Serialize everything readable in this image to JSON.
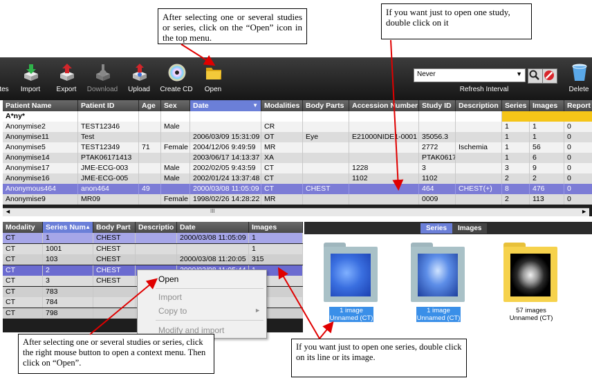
{
  "callouts": {
    "top_left": "After selecting one or several studies or series, click on the “Open” icon in the top menu.",
    "top_right": "If you want just to open one study, double click on it",
    "bottom_left": "After selecting one or several studies or series, click the right mouse button to open a context menu. Then click on “Open”.",
    "bottom_right": "If you want just to open one series, double click on its line or its image."
  },
  "toolbar": {
    "items": [
      {
        "label": "tes",
        "icon": "partial-icon"
      },
      {
        "label": "Import",
        "icon": "import-icon"
      },
      {
        "label": "Export",
        "icon": "export-icon"
      },
      {
        "label": "Download",
        "icon": "download-icon"
      },
      {
        "label": "Upload",
        "icon": "upload-icon"
      },
      {
        "label": "Create CD",
        "icon": "cd-icon"
      },
      {
        "label": "Open",
        "icon": "folder-icon"
      },
      {
        "label": "Delete",
        "icon": "trash-icon"
      }
    ],
    "refresh_value": "Never",
    "refresh_label": "Refresh Interval"
  },
  "studies": {
    "headers": [
      "Patient Name",
      "Patient ID",
      "Age",
      "Sex",
      "Date",
      "Modalities",
      "Body Parts",
      "Accession Number",
      "Study ID",
      "Description",
      "Series",
      "Images",
      "Report"
    ],
    "filter": "A*ny*",
    "rows": [
      [
        "Anonymise2",
        "TEST12346",
        "",
        "Male",
        "",
        "CR",
        "",
        "",
        "",
        "",
        "1",
        "1",
        "0"
      ],
      [
        "Anonymise11",
        "Test",
        "",
        "",
        "2006/03/09 15:31:09",
        "OT",
        "Eye",
        "E21000NIDE1-0001",
        "35056.3",
        "",
        "1",
        "1",
        "0"
      ],
      [
        "Anonymise5",
        "TEST12349",
        "71",
        "Female",
        "2004/12/06 9:49:59",
        "MR",
        "",
        "",
        "2772",
        "Ischemia",
        "1",
        "56",
        "0"
      ],
      [
        "Anonymise14",
        "PTAK06171413",
        "",
        "",
        "2003/06/17 14:13:37",
        "XA",
        "",
        "",
        "PTAK0617",
        "",
        "1",
        "6",
        "0"
      ],
      [
        "Anonymise17",
        "JME-ECG-003",
        "",
        "Male",
        "2002/02/05 9:43:59",
        "CT",
        "",
        "1228",
        "3",
        "",
        "3",
        "9",
        "0"
      ],
      [
        "Anonymise16",
        "JME-ECG-005",
        "",
        "Male",
        "2002/01/24 13:37:48",
        "CT",
        "",
        "1102",
        "1102",
        "",
        "2",
        "2",
        "0"
      ],
      [
        "Anonymous464",
        "anon464",
        "49",
        "",
        "2000/03/08 11:05:09",
        "CT",
        "CHEST",
        "",
        "464",
        "CHEST(+)",
        "8",
        "476",
        "0"
      ],
      [
        "Anonymise9",
        "MR09",
        "",
        "Female",
        "1998/02/26 14:28:22",
        "MR",
        "",
        "",
        "0009",
        "",
        "2",
        "113",
        "0"
      ]
    ],
    "scroll_handle": "III"
  },
  "series": {
    "headers": [
      "Modality",
      "Series Num",
      "Body Part",
      "Descriptio",
      "Date",
      "Images"
    ],
    "rows": [
      [
        "CT",
        "1",
        "CHEST",
        "",
        "2000/03/08 11:05:09",
        "1"
      ],
      [
        "CT",
        "1001",
        "CHEST",
        "",
        "",
        "1"
      ],
      [
        "CT",
        "103",
        "CHEST",
        "",
        "2000/03/08 11:20:05",
        "315"
      ],
      [
        "CT",
        "2",
        "CHEST",
        "",
        "2000/03/08 11:05:44",
        "1"
      ],
      [
        "CT",
        "3",
        "CHEST",
        "",
        "",
        ""
      ],
      [
        "CT",
        "783",
        "",
        "",
        "",
        ""
      ],
      [
        "CT",
        "784",
        "",
        "",
        "",
        ""
      ],
      [
        "CT",
        "798",
        "",
        "",
        "",
        ""
      ]
    ]
  },
  "thumbs": {
    "tabs": [
      "Series",
      "Images"
    ],
    "items": [
      {
        "count": "1 image",
        "name": "Unnamed (CT)"
      },
      {
        "count": "1 image",
        "name": "Unnamed (CT)"
      },
      {
        "count": "57 images",
        "name": "Unnamed (CT)"
      }
    ]
  },
  "context_menu": {
    "items": [
      "Open",
      "Import",
      "Copy to",
      "Modify and import"
    ]
  },
  "colors": {
    "accent": "#6b7fd8",
    "selected_row": "#7c7cd6",
    "highlight": "#f5c518",
    "arrow": "#e00000"
  }
}
